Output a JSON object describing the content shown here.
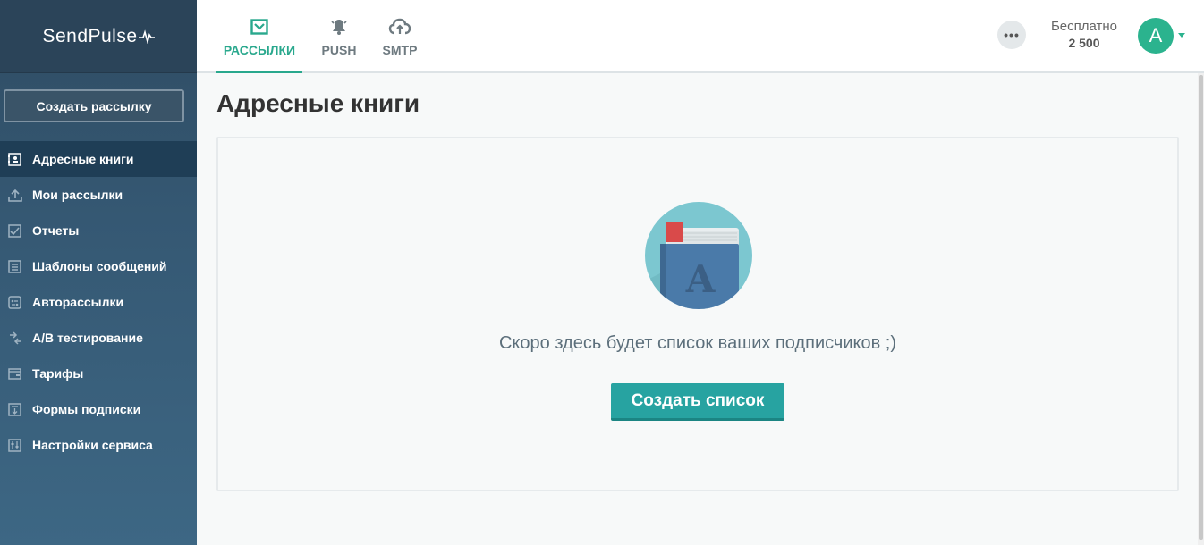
{
  "brand": {
    "name": "SendPulse"
  },
  "sidebar": {
    "create_button": "Создать рассылку",
    "items": [
      {
        "label": "Адресные книги",
        "icon": "address-book-icon",
        "active": true
      },
      {
        "label": "Мои рассылки",
        "icon": "upload-tray-icon",
        "active": false
      },
      {
        "label": "Отчеты",
        "icon": "chart-check-icon",
        "active": false
      },
      {
        "label": "Шаблоны сообщений",
        "icon": "template-icon",
        "active": false
      },
      {
        "label": "Авторассылки",
        "icon": "automation-icon",
        "active": false
      },
      {
        "label": "A/B тестирование",
        "icon": "ab-test-icon",
        "active": false
      },
      {
        "label": "Тарифы",
        "icon": "wallet-icon",
        "active": false
      },
      {
        "label": "Формы подписки",
        "icon": "form-icon",
        "active": false
      },
      {
        "label": "Настройки сервиса",
        "icon": "settings-sliders-icon",
        "active": false
      }
    ]
  },
  "header": {
    "tabs": [
      {
        "label": "РАССЫЛКИ",
        "icon": "envelope-check-icon",
        "active": true
      },
      {
        "label": "PUSH",
        "icon": "bell-icon",
        "active": false
      },
      {
        "label": "SMTP",
        "icon": "cloud-upload-icon",
        "active": false
      }
    ],
    "more_label": "•••",
    "plan": {
      "name": "Бесплатно",
      "amount": "2 500"
    },
    "avatar_letter": "A"
  },
  "main": {
    "title": "Адресные книги",
    "empty_message": "Скоро здесь будет список ваших подписчиков ;)",
    "illustration_letter": "A",
    "create_list_button": "Создать список"
  },
  "colors": {
    "accent": "#29a88d",
    "sidebar": "#355873",
    "button": "#27a3a1"
  }
}
